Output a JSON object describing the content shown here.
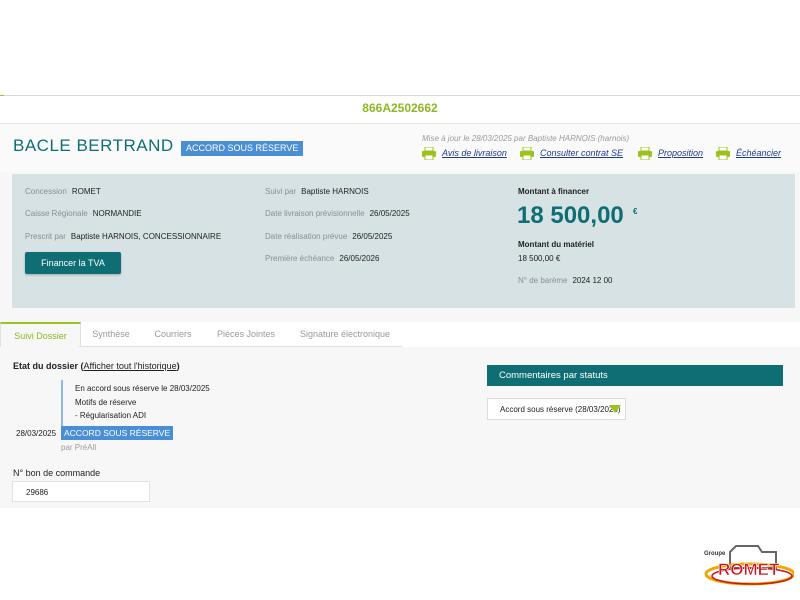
{
  "dossier": {
    "number": "866A2502662"
  },
  "header": {
    "client_name": "BACLE BERTRAND",
    "status_badge": "ACCORD SOUS RÉSERVE",
    "last_update": "Mise à jour le 28/03/2025 par Baptiste HARNOIS (harnois)",
    "actions": [
      {
        "label": "Avis de livraison",
        "icon": "printer-icon"
      },
      {
        "label": "Consulter contrat SE",
        "icon": "printer-icon"
      },
      {
        "label": "Proposition",
        "icon": "printer-icon"
      },
      {
        "label": "Échéancier",
        "icon": "printer-icon"
      }
    ]
  },
  "info": {
    "concession_label": "Concession",
    "concession_value": "ROMET",
    "caisse_label": "Caisse Régionale",
    "caisse_value": "NORMANDIE",
    "prescrit_label": "Prescrit par",
    "prescrit_value": "Baptiste HARNOIS, CONCESSIONNAIRE",
    "tva_button": "Financer la TVA",
    "suivi_label": "Suivi par",
    "suivi_value": "Baptiste HARNOIS",
    "date_livraison_label": "Date livraison prévisionnelle",
    "date_livraison_value": "26/05/2025",
    "date_realisation_label": "Date réalisation prévue",
    "date_realisation_value": "26/05/2025",
    "premiere_echeance_label": "Première échéance",
    "premiere_echeance_value": "26/05/2026",
    "montant_label": "Montant à financer",
    "montant_value": "18 500,00",
    "montant_currency": "€",
    "materiel_label": "Montant du matériel",
    "materiel_value": "18 500,00 €",
    "bareme_label": "N° de barème",
    "bareme_value": "2024 12 00"
  },
  "tabs": [
    {
      "label": "Suivi Dossier",
      "active": true
    },
    {
      "label": "Synthèse",
      "active": false
    },
    {
      "label": "Courriers",
      "active": false
    },
    {
      "label": "Pièces Jointes",
      "active": false
    },
    {
      "label": "Signature électronique",
      "active": false
    }
  ],
  "suivi": {
    "etat_title": "Etat du dossier",
    "history_link": "Afficher tout l'historique",
    "timeline": {
      "line1": "En accord sous réserve le 28/03/2025",
      "line2": "Motifs de réserve",
      "line3": "- Régularisation ADI",
      "date": "28/03/2025",
      "status": "ACCORD SOUS RÉSERVE",
      "by": "par PréAll"
    },
    "bon_label": "N° bon de commande",
    "bon_value": "29686"
  },
  "comments": {
    "header": "Commentaires par statuts",
    "select_value": "Accord sous réserve (28/03/2025)"
  },
  "logo": {
    "small": "Groupe",
    "name": "ROMET"
  },
  "colors": {
    "teal": "#0e6e74",
    "green": "#9bc31c",
    "badge_blue": "#4a8fd6",
    "panel": "#d6e2e4"
  }
}
